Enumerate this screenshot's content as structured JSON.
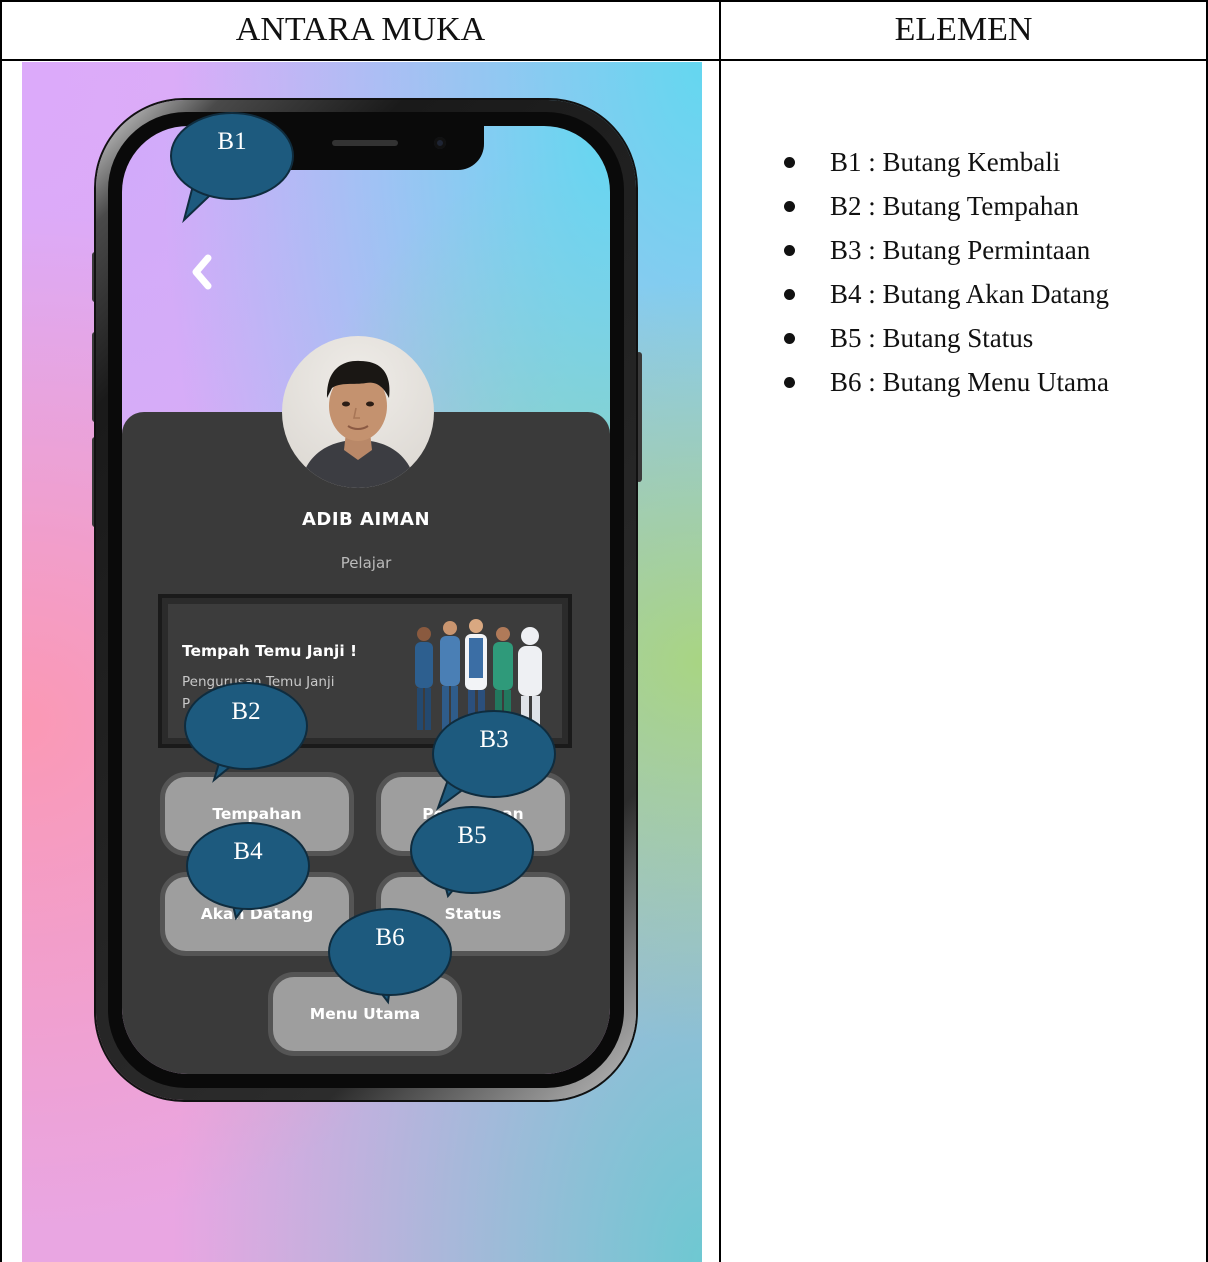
{
  "table": {
    "col1_header": "ANTARA MUKA",
    "col2_header": "ELEMEN"
  },
  "phone": {
    "profile": {
      "name": "ADIB AIMAN",
      "role": "Pelajar"
    },
    "banner": {
      "title": "Tempah Temu Janji !",
      "subtitle_line1": "Pengurusan Temu Janji",
      "subtitle_line2": "P"
    },
    "buttons": {
      "tempahan": "Tempahan",
      "permintaan": "Permintaan",
      "akan_datang": "Akan Datang",
      "status": "Status",
      "menu_utama": "Menu Utama"
    },
    "back_icon": "chevron-left-icon"
  },
  "callouts": {
    "b1": "B1",
    "b2": "B2",
    "b3": "B3",
    "b4": "B4",
    "b5": "B5",
    "b6": "B6"
  },
  "legend": [
    "B1 : Butang Kembali",
    "B2 : Butang Tempahan",
    "B3 : Butang Permintaan",
    "B4 : Butang Akan Datang",
    "B5 : Butang Status",
    "B6 : Butang Menu Utama"
  ],
  "colors": {
    "callout_fill": "#1d5a7e",
    "card_dark": "#3a3a3a",
    "button_gray": "#9e9e9e"
  }
}
